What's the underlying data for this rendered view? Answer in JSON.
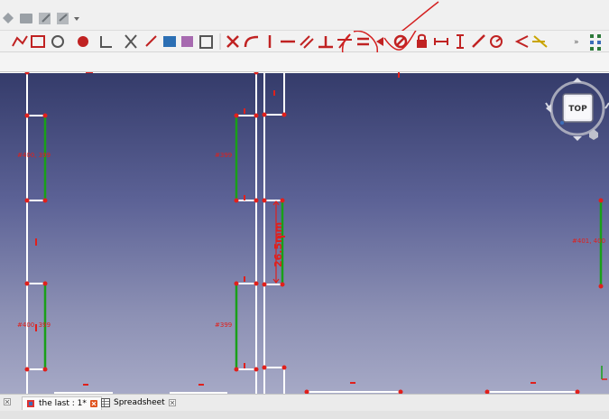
{
  "tabs": [
    {
      "label": "the last : 1*",
      "active": true
    },
    {
      "label": "Spreadsheet",
      "active": false
    }
  ],
  "dimensions": {
    "main": "26.5mm",
    "c1": "#400, 399",
    "c2": "#399",
    "c3": "#401, 400",
    "c4": "#400, 399",
    "c5": "#399",
    "nav_cube": "TOP"
  },
  "colors": {
    "constraint_red": "#e0201c",
    "edge_white": "#ffffff",
    "edge_green": "#19a019",
    "annotation_red": "#d42020"
  },
  "icons": {
    "toolbar_top": [
      "navigation-icon",
      "folder-icon",
      "edit-icon",
      "share-icon",
      "dropdown-icon"
    ],
    "sketch_tools": [
      "polyline-icon",
      "rectangle-icon",
      "polygon-icon",
      "fillet-icon",
      "trim-icon",
      "extend-icon",
      "external-geometry-icon",
      "carbon-copy-icon",
      "clone-icon",
      "array-icon"
    ],
    "constraints": [
      "coincident-icon",
      "point-on-object-icon",
      "vertical-icon",
      "horizontal-icon",
      "parallel-icon",
      "perpendicular-icon",
      "tangent-icon",
      "equal-icon",
      "symmetric-icon",
      "block-icon",
      "lock-icon",
      "horizontal-distance-icon",
      "vertical-distance-icon",
      "distance-icon",
      "radius-icon",
      "angle-icon",
      "snell-icon"
    ]
  }
}
